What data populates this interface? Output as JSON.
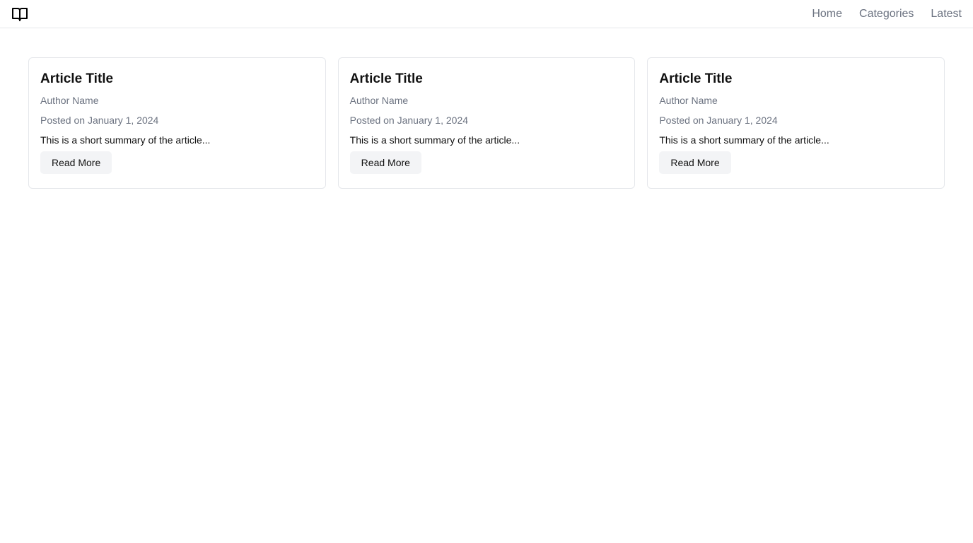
{
  "header": {
    "logo_icon": "open-book-icon",
    "nav": [
      {
        "label": "Home"
      },
      {
        "label": "Categories"
      },
      {
        "label": "Latest"
      }
    ]
  },
  "articles": [
    {
      "title": "Article Title",
      "author": "Author Name",
      "date": "Posted on January 1, 2024",
      "summary": "This is a short summary of the article...",
      "button_label": "Read More"
    },
    {
      "title": "Article Title",
      "author": "Author Name",
      "date": "Posted on January 1, 2024",
      "summary": "This is a short summary of the article...",
      "button_label": "Read More"
    },
    {
      "title": "Article Title",
      "author": "Author Name",
      "date": "Posted on January 1, 2024",
      "summary": "This is a short summary of the article...",
      "button_label": "Read More"
    }
  ],
  "colors": {
    "muted_text": "#6b7280",
    "border": "#e5e7eb",
    "button_bg": "#f3f4f6"
  }
}
